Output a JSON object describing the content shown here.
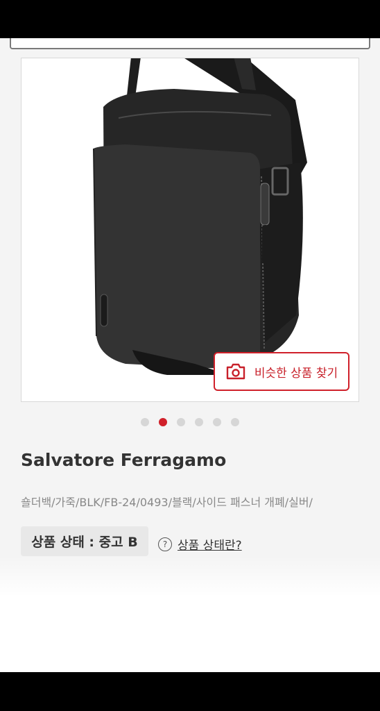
{
  "product": {
    "image_alt": "Black leather shoulder bag",
    "find_similar_label": "비슷한 상품 찾기",
    "carousel": {
      "total": 6,
      "active_index": 1
    },
    "brand": "Salvatore Ferragamo",
    "description": "숄더백/가죽/BLK/FB-24/0493/블랙/사이드 패스너 개폐/실버/",
    "condition_label": "상품 상태 : 중고 B",
    "condition_help_link": "상품 상태란?"
  },
  "icons": {
    "camera": "camera-icon",
    "help": "question-circle-icon"
  },
  "colors": {
    "accent": "#d0202a",
    "text_primary": "#333333",
    "text_secondary": "#888888"
  }
}
